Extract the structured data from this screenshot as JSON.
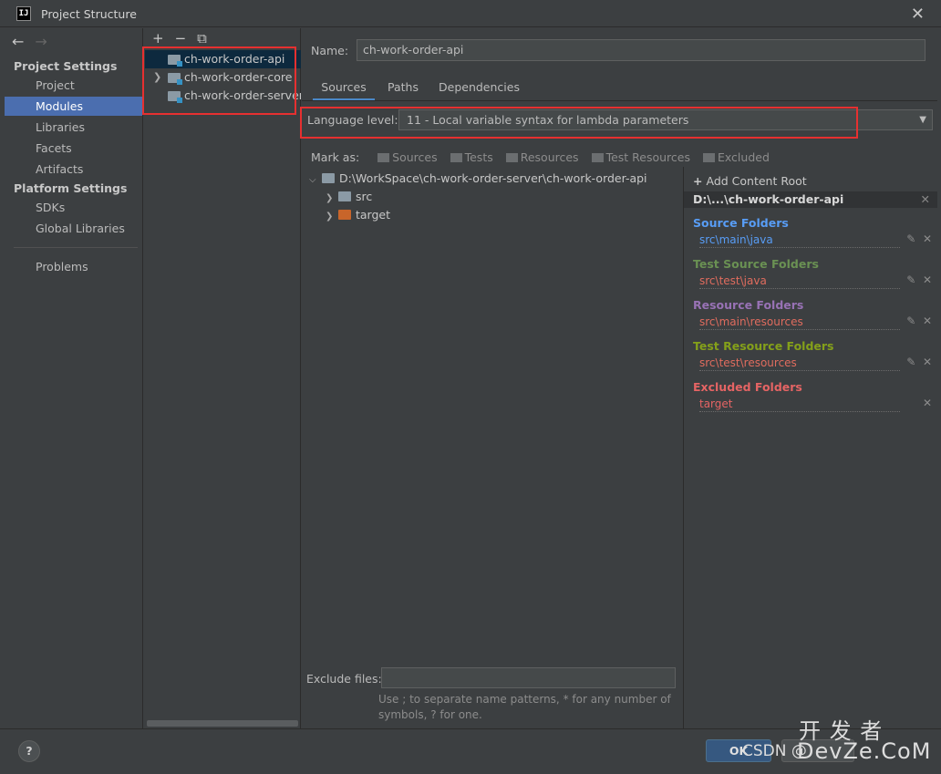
{
  "window": {
    "title": "Project Structure",
    "app_icon": "IJ"
  },
  "nav": {
    "project_settings": "Project Settings",
    "items_project": [
      {
        "label": "Project"
      },
      {
        "label": "Modules"
      },
      {
        "label": "Libraries"
      },
      {
        "label": "Facets"
      },
      {
        "label": "Artifacts"
      }
    ],
    "platform_settings": "Platform Settings",
    "items_platform": [
      {
        "label": "SDKs"
      },
      {
        "label": "Global Libraries"
      }
    ],
    "problems": "Problems",
    "selected": "Modules"
  },
  "modules": {
    "list": [
      {
        "name": "ch-work-order-api"
      },
      {
        "name": "ch-work-order-core"
      },
      {
        "name": "ch-work-order-server"
      }
    ]
  },
  "main": {
    "name_label": "Name:",
    "name_value": "ch-work-order-api",
    "tabs": [
      {
        "label": "Sources"
      },
      {
        "label": "Paths"
      },
      {
        "label": "Dependencies"
      }
    ],
    "language_label": "Language level:",
    "language_value": "11 - Local variable syntax for lambda parameters",
    "mark_as": {
      "label": "Mark as:",
      "options": [
        "Sources",
        "Tests",
        "Resources",
        "Test Resources",
        "Excluded"
      ]
    },
    "tree": {
      "root": "D:\\WorkSpace\\ch-work-order-server\\ch-work-order-api",
      "children": [
        "src",
        "target"
      ]
    },
    "exclude_label": "Exclude files:",
    "exclude_value": "",
    "exclude_help": "Use ; to separate name patterns, * for any number of symbols, ? for one."
  },
  "roots": {
    "add_label": "Add Content Root",
    "root_path": "D:\\...\\ch-work-order-api",
    "groups": [
      {
        "title": "Source Folders",
        "path": "src\\main\\java"
      },
      {
        "title": "Test Source Folders",
        "path": "src\\test\\java"
      },
      {
        "title": "Resource Folders",
        "path": "src\\main\\resources"
      },
      {
        "title": "Test Resource Folders",
        "path": "src\\test\\resources"
      },
      {
        "title": "Excluded Folders",
        "path": "target"
      }
    ]
  },
  "footer": {
    "help": "?",
    "ok": "OK",
    "watermark_left": "CSDN @",
    "watermark_cn": "开 发 者",
    "watermark_site": "DevZe.CoM"
  },
  "colors": {
    "selection": "#4b6eaf",
    "highlight_box": "#e63030",
    "source": "#589df6",
    "test": "#6a9153",
    "resource": "#9872b5",
    "test_resource": "#84a01a",
    "excluded": "#e56464"
  }
}
